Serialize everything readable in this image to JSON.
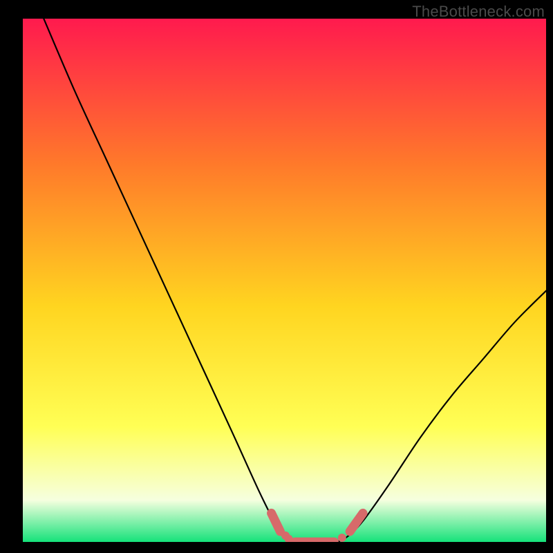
{
  "watermark": "TheBottleneck.com",
  "colors": {
    "background": "#000000",
    "gradient_top": "#ff1a4e",
    "gradient_upper_mid": "#ff7a2a",
    "gradient_mid": "#ffd520",
    "gradient_lower_mid": "#ffff55",
    "gradient_pale": "#f6ffdf",
    "gradient_bottom": "#15e27a",
    "curve_stroke": "#000000",
    "marker_fill": "#d76a6a"
  },
  "chart_data": {
    "type": "line",
    "title": "",
    "xlabel": "",
    "ylabel": "",
    "xlim": [
      0,
      100
    ],
    "ylim": [
      0,
      100
    ],
    "grid": false,
    "watermark": "TheBottleneck.com",
    "series": [
      {
        "name": "left-branch",
        "x": [
          4,
          10,
          16,
          22,
          28,
          34,
          40,
          45,
          48,
          50,
          52,
          54
        ],
        "y": [
          100,
          86,
          73,
          60,
          47,
          34,
          21,
          10,
          4,
          1,
          0,
          0
        ]
      },
      {
        "name": "flat-bottom",
        "x": [
          52,
          54,
          56,
          58,
          60
        ],
        "y": [
          0,
          0,
          0,
          0,
          0
        ]
      },
      {
        "name": "right-branch",
        "x": [
          60,
          62,
          65,
          70,
          76,
          82,
          88,
          94,
          100
        ],
        "y": [
          0,
          1,
          4,
          11,
          20,
          28,
          35,
          42,
          48
        ]
      }
    ],
    "markers": [
      {
        "name": "pink-segment-left",
        "shape": "capsule",
        "x1": 47.5,
        "y1": 5.5,
        "x2": 49.2,
        "y2": 2.0
      },
      {
        "name": "pink-dot-1",
        "shape": "dot",
        "x": 50.2,
        "y": 1.2
      },
      {
        "name": "pink-dot-2",
        "shape": "dot",
        "x": 50.8,
        "y": 0.6
      },
      {
        "name": "pink-segment-bottom",
        "shape": "capsule",
        "x1": 52.0,
        "y1": 0.0,
        "x2": 59.5,
        "y2": 0.0
      },
      {
        "name": "pink-dot-3",
        "shape": "dot",
        "x": 61.0,
        "y": 0.8
      },
      {
        "name": "pink-segment-right",
        "shape": "capsule",
        "x1": 62.5,
        "y1": 2.0,
        "x2": 65.0,
        "y2": 5.5
      }
    ]
  }
}
